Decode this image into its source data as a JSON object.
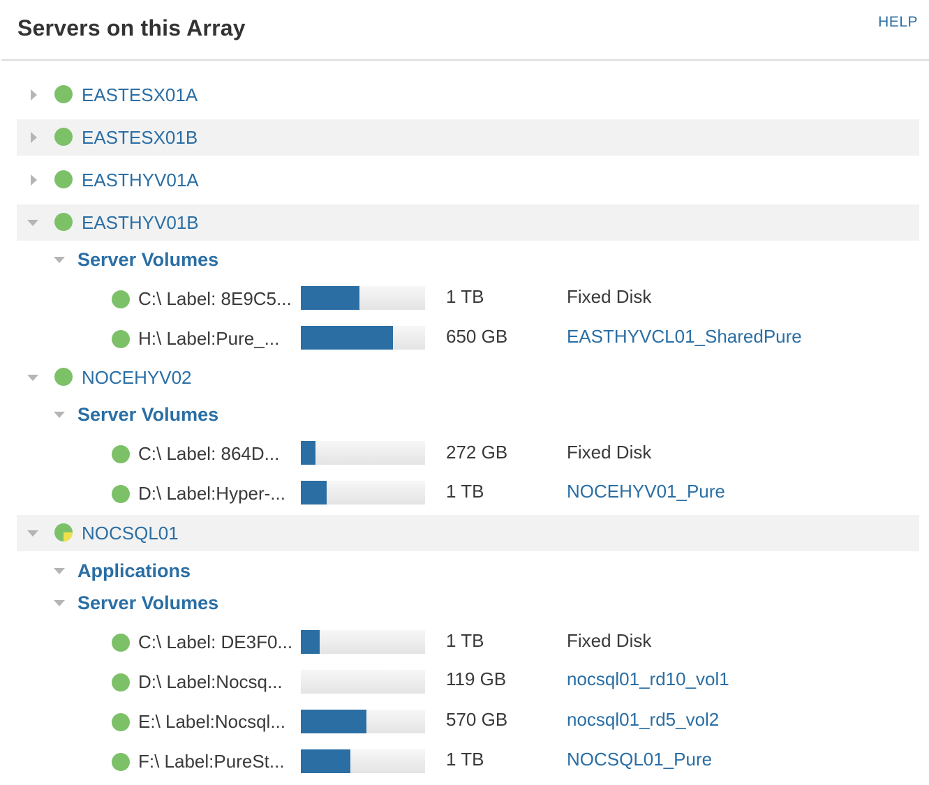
{
  "header": {
    "title": "Servers on this Array",
    "help_label": "HELP"
  },
  "colors": {
    "link_blue": "#2a6ea4",
    "status_ok": "#7cc168",
    "status_warning": "#efe14b",
    "row_shade": "#f2f2f2"
  },
  "servers": [
    {
      "name": "EASTESX01A",
      "expanded": false,
      "status": "ok"
    },
    {
      "name": "EASTESX01B",
      "expanded": false,
      "status": "ok"
    },
    {
      "name": "EASTHYV01A",
      "expanded": false,
      "status": "ok"
    },
    {
      "name": "EASTHYV01B",
      "expanded": true,
      "status": "ok",
      "groups": [
        {
          "label": "Server Volumes",
          "expanded": true
        }
      ],
      "volumes": [
        {
          "label": "C:\\ Label: 8E9C5...",
          "usage_fraction": 0.47,
          "size": "1 TB",
          "target": "Fixed Disk",
          "target_is_link": false
        },
        {
          "label": "H:\\ Label:Pure_...",
          "usage_fraction": 0.74,
          "size": "650 GB",
          "target": "EASTHYVCL01_SharedPure",
          "target_is_link": true
        }
      ]
    },
    {
      "name": "NOCEHYV02",
      "expanded": true,
      "status": "ok",
      "groups": [
        {
          "label": "Server Volumes",
          "expanded": true
        }
      ],
      "volumes": [
        {
          "label": "C:\\ Label: 864D...",
          "usage_fraction": 0.12,
          "size": "272 GB",
          "target": "Fixed Disk",
          "target_is_link": false
        },
        {
          "label": "D:\\ Label:Hyper-...",
          "usage_fraction": 0.21,
          "size": "1 TB",
          "target": "NOCEHYV01_Pure",
          "target_is_link": true
        }
      ]
    },
    {
      "name": "NOCSQL01",
      "expanded": true,
      "status": "warning",
      "groups": [
        {
          "label": "Applications",
          "expanded": true
        },
        {
          "label": "Server Volumes",
          "expanded": true
        }
      ],
      "volumes": [
        {
          "label": "C:\\ Label: DE3F0...",
          "usage_fraction": 0.15,
          "size": "1 TB",
          "target": "Fixed Disk",
          "target_is_link": false
        },
        {
          "label": "D:\\ Label:Nocsq...",
          "usage_fraction": 0.0,
          "size": "119 GB",
          "target": "nocsql01_rd10_vol1",
          "target_is_link": true
        },
        {
          "label": "E:\\ Label:Nocsql...",
          "usage_fraction": 0.53,
          "size": "570 GB",
          "target": "nocsql01_rd5_vol2",
          "target_is_link": true
        },
        {
          "label": "F:\\ Label:PureSt...",
          "usage_fraction": 0.4,
          "size": "1 TB",
          "target": "NOCSQL01_Pure",
          "target_is_link": true
        }
      ]
    }
  ]
}
